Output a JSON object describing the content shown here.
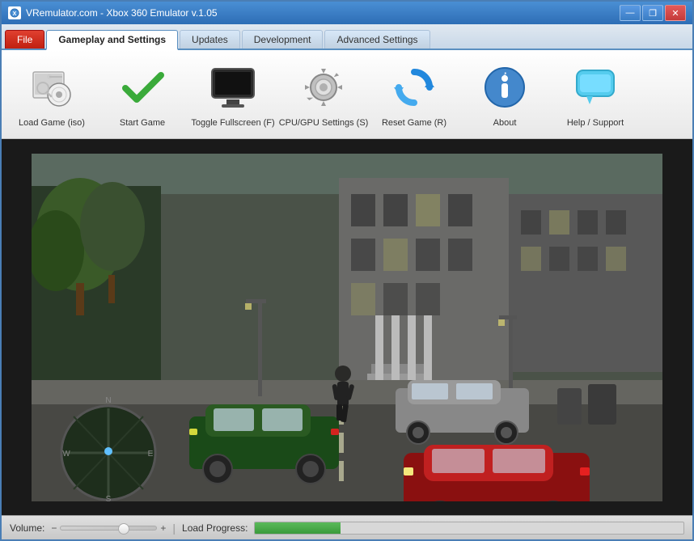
{
  "window": {
    "title": "VRemulator.com - Xbox 360 Emulator v.1.05",
    "controls": {
      "minimize": "—",
      "restore": "❐",
      "close": "✕"
    }
  },
  "tabs": [
    {
      "id": "file",
      "label": "File",
      "active": false
    },
    {
      "id": "gameplay",
      "label": "Gameplay and Settings",
      "active": true
    },
    {
      "id": "updates",
      "label": "Updates",
      "active": false
    },
    {
      "id": "development",
      "label": "Development",
      "active": false
    },
    {
      "id": "advanced",
      "label": "Advanced Settings",
      "active": false
    }
  ],
  "toolbar": {
    "buttons": [
      {
        "id": "load-game",
        "label": "Load Game (iso)",
        "icon": "load-icon"
      },
      {
        "id": "start-game",
        "label": "Start Game",
        "icon": "check-icon"
      },
      {
        "id": "toggle-fullscreen",
        "label": "Toggle Fullscreen (F)",
        "icon": "monitor-icon"
      },
      {
        "id": "cpu-gpu-settings",
        "label": "CPU/GPU Settings (S)",
        "icon": "gear-icon"
      },
      {
        "id": "reset-game",
        "label": "Reset Game (R)",
        "icon": "reset-icon"
      },
      {
        "id": "about",
        "label": "About",
        "icon": "info-icon"
      },
      {
        "id": "help-support",
        "label": "Help / Support",
        "icon": "chat-icon"
      }
    ]
  },
  "status_bar": {
    "volume_label": "Volume:",
    "progress_label": "Load Progress:",
    "progress_value": 20,
    "separator": "|"
  }
}
